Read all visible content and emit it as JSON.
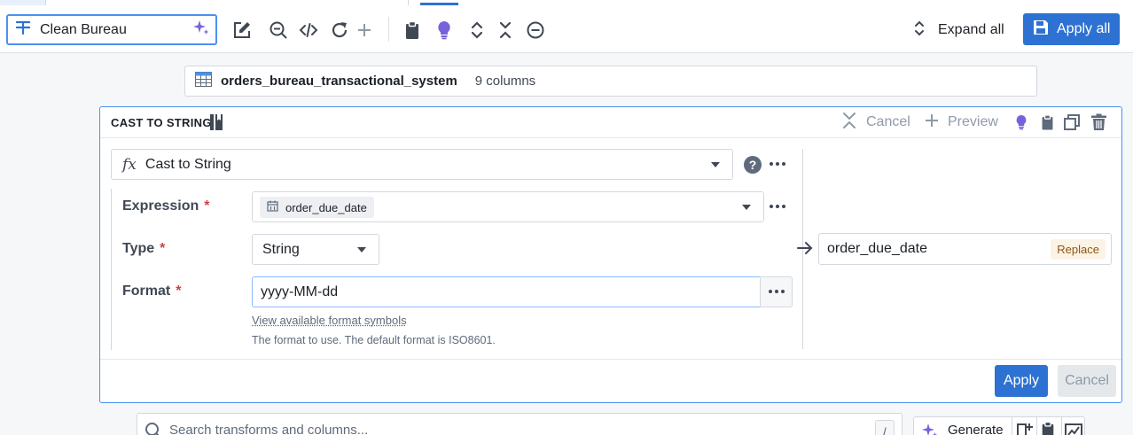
{
  "toolbar": {
    "pipeline_name": "Clean Bureau",
    "expand_all_label": "Expand all",
    "apply_all_label": "Apply all"
  },
  "dataset": {
    "name": "orders_bureau_transactional_system",
    "columns_label": "9 columns"
  },
  "transform": {
    "header_title": "CAST TO STRING",
    "cancel_label": "Cancel",
    "preview_label": "Preview",
    "function_name": "Cast to String",
    "function_icon": "fx",
    "expression_label": "Expression",
    "expression_value": "order_due_date",
    "type_label": "Type",
    "type_value": "String",
    "format_label": "Format",
    "format_value": "yyyy-MM-dd",
    "format_link": "View available format symbols",
    "format_help": "The format to use. The default format is ISO8601.",
    "required_mark": "*",
    "output_column": "order_due_date",
    "output_mode": "Replace",
    "apply_label": "Apply",
    "footer_cancel_label": "Cancel"
  },
  "search": {
    "placeholder": "Search transforms and columns...",
    "shortcut": "/",
    "generate_label": "Generate"
  },
  "colors": {
    "primary": "#2d72d2",
    "ai_purple": "#7961db",
    "required_red": "#cd4246"
  }
}
